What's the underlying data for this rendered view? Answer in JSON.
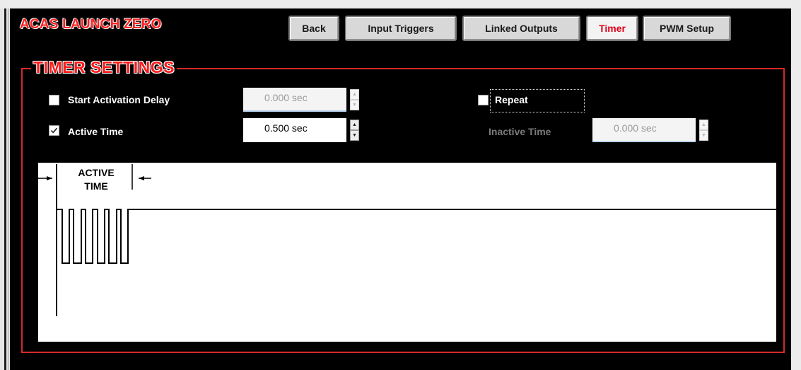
{
  "app": {
    "title": "ACAS LAUNCH ZERO"
  },
  "nav": {
    "tabs": [
      {
        "label": "Back",
        "active": false
      },
      {
        "label": "Input Triggers",
        "active": false
      },
      {
        "label": "Linked Outputs",
        "active": false
      },
      {
        "label": "Timer",
        "active": true
      },
      {
        "label": "PWM Setup",
        "active": false
      }
    ]
  },
  "timer_settings": {
    "title": "TIMER SETTINGS",
    "start_activation_delay": {
      "label": "Start Activation Delay",
      "checked": false,
      "value": "0.000 sec",
      "enabled": false
    },
    "active_time": {
      "label": "Active Time",
      "checked": true,
      "value": "0.500 sec",
      "enabled": true
    },
    "repeat": {
      "label": "Repeat",
      "checked": false
    },
    "inactive_time": {
      "label": "Inactive Time",
      "value": "0.000 sec",
      "enabled": false
    }
  },
  "diagram": {
    "label_line1": "ACTIVE",
    "label_line2": "TIME"
  },
  "colors": {
    "accent": "#ff1a1a",
    "frame": "#d42a2a",
    "background": "#000000",
    "active_tab_text": "#e0001a"
  }
}
